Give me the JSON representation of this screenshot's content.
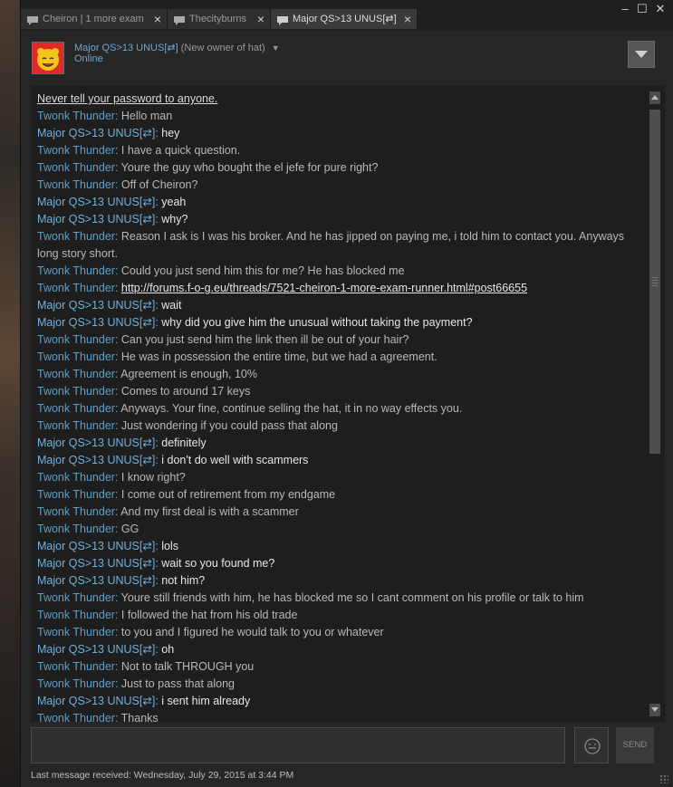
{
  "tabs": [
    {
      "label": "Cheiron | 1 more exam",
      "active": false,
      "icon": "chat-bubble-icon"
    },
    {
      "label": "Thecityburns",
      "active": false,
      "icon": "chat-bubble-icon"
    },
    {
      "label": "Major QS>13 UNUS[⇄]",
      "active": true,
      "icon": "chat-bubble-icon"
    }
  ],
  "window_controls": {
    "minimize": "–",
    "maximize": "☐",
    "close": "✕"
  },
  "header": {
    "name": "Major QS>13 UNUS[⇄]",
    "nickname": "(New owner of hat)",
    "status": "Online"
  },
  "chat": {
    "notice": "Never tell your password to anyone.",
    "messages": [
      {
        "sender": "Twonk Thunder",
        "text": "Hello man"
      },
      {
        "sender": "Major QS>13 UNUS[⇄]",
        "text": "hey"
      },
      {
        "sender": "Twonk Thunder",
        "text": "I have a quick question."
      },
      {
        "sender": "Twonk Thunder",
        "text": "Youre the guy who bought the el jefe for pure right?"
      },
      {
        "sender": "Twonk Thunder",
        "text": "Off of Cheiron?"
      },
      {
        "sender": "Major QS>13 UNUS[⇄]",
        "text": "yeah"
      },
      {
        "sender": "Major QS>13 UNUS[⇄]",
        "text": "why?"
      },
      {
        "sender": "Twonk Thunder",
        "text": "Reason I ask is I was his broker. And he has jipped on paying me, i told him to contact you. Anyways long story short."
      },
      {
        "sender": "Twonk Thunder",
        "text": "Could you just send him this for me? He has blocked me"
      },
      {
        "sender": "Twonk Thunder",
        "text": "http://forums.f-o-g.eu/threads/7521-cheiron-1-more-exam-runner.html#post66655"
      },
      {
        "sender": "Major QS>13 UNUS[⇄]",
        "text": "wait"
      },
      {
        "sender": "Major QS>13 UNUS[⇄]",
        "text": "why did you give him the unusual without taking the payment?"
      },
      {
        "sender": "Twonk Thunder",
        "text": "Can you just send him the link then ill be out of your hair?"
      },
      {
        "sender": "Twonk Thunder",
        "text": "He was in possession the entire time, but we had a agreement."
      },
      {
        "sender": "Twonk Thunder",
        "text": "Agreement is enough, 10%"
      },
      {
        "sender": "Twonk Thunder",
        "text": "Comes to around 17 keys"
      },
      {
        "sender": "Twonk Thunder",
        "text": "Anyways. Your fine, continue selling the hat, it in no way effects you."
      },
      {
        "sender": "Twonk Thunder",
        "text": "Just wondering if you could pass that along"
      },
      {
        "sender": "Major QS>13 UNUS[⇄]",
        "text": "definitely"
      },
      {
        "sender": "Major QS>13 UNUS[⇄]",
        "text": "i don't do well with scammers"
      },
      {
        "sender": "Twonk Thunder",
        "text": "I know right?"
      },
      {
        "sender": "Twonk Thunder",
        "text": "I come out of retirement from my endgame"
      },
      {
        "sender": "Twonk Thunder",
        "text": "And my first deal is with a scammer"
      },
      {
        "sender": "Twonk Thunder",
        "text": "GG"
      },
      {
        "sender": "Major QS>13 UNUS[⇄]",
        "text": "lols"
      },
      {
        "sender": "Major QS>13 UNUS[⇄]",
        "text": "wait so you found me?"
      },
      {
        "sender": "Major QS>13 UNUS[⇄]",
        "text": "not him?"
      },
      {
        "sender": "Twonk Thunder",
        "text": "Youre still friends with him, he has blocked me so I cant comment on his profile or talk to him"
      },
      {
        "sender": "Twonk Thunder",
        "text": "I followed the hat from his old trade"
      },
      {
        "sender": "Twonk Thunder",
        "text": "to you and I figured he would talk to you or whatever"
      },
      {
        "sender": "Major QS>13 UNUS[⇄]",
        "text": "oh"
      },
      {
        "sender": "Twonk Thunder",
        "text": "Not to talk THROUGH you"
      },
      {
        "sender": "Twonk Thunder",
        "text": "Just to pass that along"
      },
      {
        "sender": "Major QS>13 UNUS[⇄]",
        "text": "i sent him already"
      },
      {
        "sender": "Twonk Thunder",
        "text": "Thanks"
      }
    ]
  },
  "send_label": "SEND",
  "footer": "Last message received: Wednesday, July 29, 2015 at 3:44 PM",
  "colors": {
    "sender_twonk": "#5e9fc7",
    "sender_major": "#6fb0dc",
    "background": "#262626",
    "chat_background": "#1e1e1e"
  }
}
